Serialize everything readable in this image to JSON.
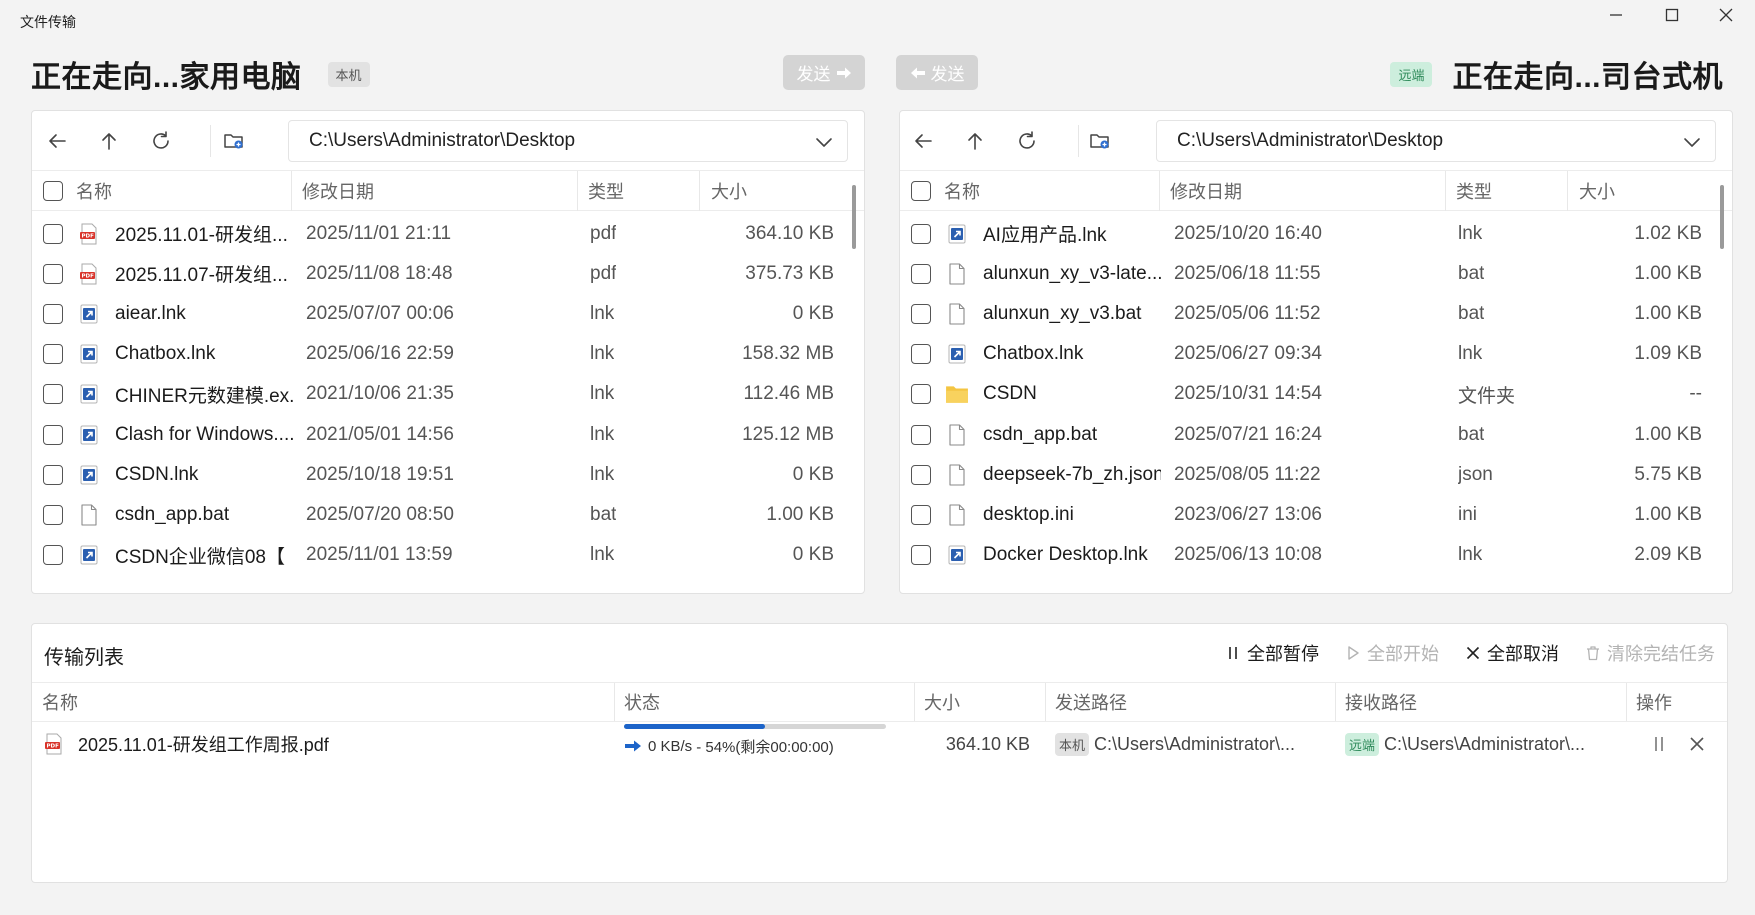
{
  "window": {
    "title": "文件传输"
  },
  "local": {
    "title": "正在走向...家用电脑",
    "badge": "本机",
    "send_label": "发送",
    "path": "C:\\Users\\Administrator\\Desktop",
    "columns": {
      "name": "名称",
      "date": "修改日期",
      "type": "类型",
      "size": "大小"
    },
    "files": [
      {
        "name": "2025.11.01-研发组...",
        "date": "2025/11/01 21:11",
        "type": "pdf",
        "size": "364.10 KB",
        "icon": "pdf-icon"
      },
      {
        "name": "2025.11.07-研发组...",
        "date": "2025/11/08 18:48",
        "type": "pdf",
        "size": "375.73 KB",
        "icon": "pdf-icon"
      },
      {
        "name": "aiear.lnk",
        "date": "2025/07/07 00:06",
        "type": "lnk",
        "size": "0 KB",
        "icon": "shortcut-icon"
      },
      {
        "name": "Chatbox.lnk",
        "date": "2025/06/16 22:59",
        "type": "lnk",
        "size": "158.32 MB",
        "icon": "shortcut-icon"
      },
      {
        "name": "CHINER元数建模.ex...",
        "date": "2021/10/06 21:35",
        "type": "lnk",
        "size": "112.46 MB",
        "icon": "shortcut-icon"
      },
      {
        "name": "Clash for Windows....",
        "date": "2021/05/01 14:56",
        "type": "lnk",
        "size": "125.12 MB",
        "icon": "shortcut-icon"
      },
      {
        "name": "CSDN.lnk",
        "date": "2025/10/18 19:51",
        "type": "lnk",
        "size": "0 KB",
        "icon": "shortcut-icon"
      },
      {
        "name": "csdn_app.bat",
        "date": "2025/07/20 08:50",
        "type": "bat",
        "size": "1.00 KB",
        "icon": "file-icon"
      },
      {
        "name": "CSDN企业微信08【",
        "date": "2025/11/01 13:59",
        "type": "lnk",
        "size": "0 KB",
        "icon": "shortcut-icon"
      }
    ]
  },
  "remote": {
    "title": "正在走向...司台式机",
    "badge": "远端",
    "send_label": "发送",
    "path": "C:\\Users\\Administrator\\Desktop",
    "columns": {
      "name": "名称",
      "date": "修改日期",
      "type": "类型",
      "size": "大小"
    },
    "files": [
      {
        "name": "AI应用产品.lnk",
        "date": "2025/10/20 16:40",
        "type": "lnk",
        "size": "1.02 KB",
        "icon": "shortcut-icon"
      },
      {
        "name": "alunxun_xy_v3-late...",
        "date": "2025/06/18 11:55",
        "type": "bat",
        "size": "1.00 KB",
        "icon": "file-icon"
      },
      {
        "name": "alunxun_xy_v3.bat",
        "date": "2025/05/06 11:52",
        "type": "bat",
        "size": "1.00 KB",
        "icon": "file-icon"
      },
      {
        "name": "Chatbox.lnk",
        "date": "2025/06/27 09:34",
        "type": "lnk",
        "size": "1.09 KB",
        "icon": "shortcut-icon"
      },
      {
        "name": "CSDN",
        "date": "2025/10/31 14:54",
        "type": "文件夹",
        "size": "--",
        "icon": "folder-icon"
      },
      {
        "name": "csdn_app.bat",
        "date": "2025/07/21 16:24",
        "type": "bat",
        "size": "1.00 KB",
        "icon": "file-icon"
      },
      {
        "name": "deepseek-7b_zh.json",
        "date": "2025/08/05 11:22",
        "type": "json",
        "size": "5.75 KB",
        "icon": "file-icon"
      },
      {
        "name": "desktop.ini",
        "date": "2023/06/27 13:06",
        "type": "ini",
        "size": "1.00 KB",
        "icon": "file-icon"
      },
      {
        "name": "Docker Desktop.lnk",
        "date": "2025/06/13 10:08",
        "type": "lnk",
        "size": "2.09 KB",
        "icon": "shortcut-icon"
      }
    ]
  },
  "transfer": {
    "title": "传输列表",
    "actions": {
      "pause_all": "全部暂停",
      "start_all": "全部开始",
      "cancel_all": "全部取消",
      "clear_done": "清除完结任务"
    },
    "columns": {
      "name": "名称",
      "status": "状态",
      "size": "大小",
      "send_path": "发送路径",
      "recv_path": "接收路径",
      "ops": "操作"
    },
    "tasks": [
      {
        "name": "2025.11.01-研发组工作周报.pdf",
        "speed": "0 KB/s",
        "progress_text": "- 54%(剩余00:00:00)",
        "progress": 0.54,
        "size": "364.10 KB",
        "send_badge": "本机",
        "send_path": "C:\\Users\\Administrator\\...",
        "recv_badge": "远端",
        "recv_path": "C:\\Users\\Administrator\\..."
      }
    ]
  },
  "colors": {
    "accent": "#1d64c9",
    "remote_badge_bg": "#cdeedd",
    "remote_badge_fg": "#2e8a5a",
    "pdf_red": "#d9342b",
    "shortcut_blue": "#2b5fb0",
    "folder_yellow": "#f4c542"
  }
}
